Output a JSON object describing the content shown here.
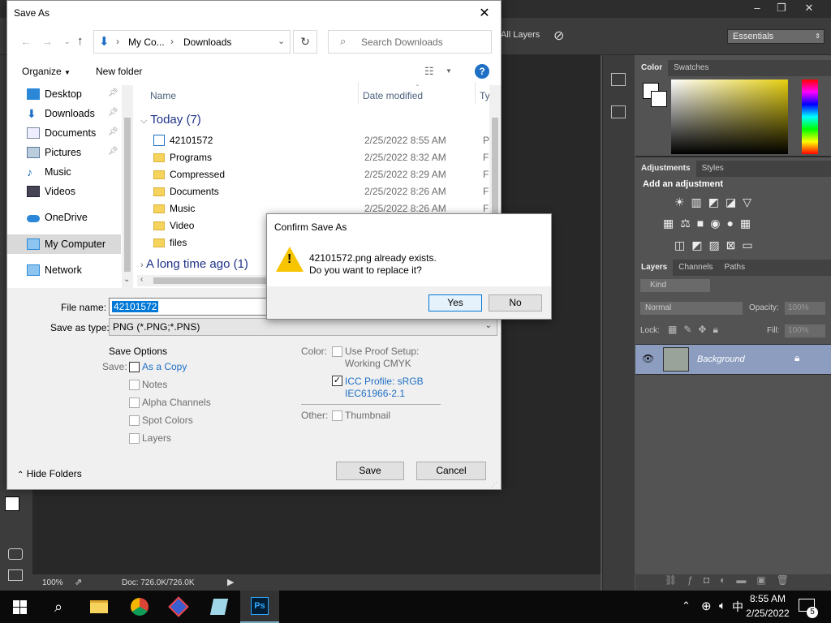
{
  "photoshop": {
    "layers_toggle": "All Layers",
    "workspace": "Essentials",
    "status_zoom": "100%",
    "status_doc": "Doc: 726.0K/726.0K",
    "color_panel": {
      "tabs": [
        "Color",
        "Swatches"
      ]
    },
    "adjustments_panel": {
      "tabs": [
        "Adjustments",
        "Styles"
      ],
      "heading": "Add an adjustment"
    },
    "layers_panel": {
      "tabs": [
        "Layers",
        "Channels",
        "Paths"
      ],
      "kind_filter": "Kind",
      "blend_mode": "Normal",
      "opacity_label": "Opacity:",
      "opacity_value": "100%",
      "lock_label": "Lock:",
      "fill_label": "Fill:",
      "fill_value": "100%",
      "layer_name": "Background"
    }
  },
  "save_dialog": {
    "title": "Save As",
    "breadcrumb": [
      "My Co...",
      "Downloads"
    ],
    "search_placeholder": "Search Downloads",
    "organize": "Organize",
    "new_folder": "New folder",
    "sidebar": [
      {
        "label": "Desktop",
        "icon": "desktop-icon",
        "pinned": true
      },
      {
        "label": "Downloads",
        "icon": "downloads-icon",
        "pinned": true
      },
      {
        "label": "Documents",
        "icon": "documents-icon",
        "pinned": true
      },
      {
        "label": "Pictures",
        "icon": "pictures-icon",
        "pinned": true
      },
      {
        "label": "Music",
        "icon": "music-icon",
        "pinned": false
      },
      {
        "label": "Videos",
        "icon": "videos-icon",
        "pinned": false
      },
      {
        "label": "OneDrive",
        "icon": "onedrive-icon",
        "pinned": false
      },
      {
        "label": "My Computer",
        "icon": "computer-icon",
        "pinned": false
      },
      {
        "label": "Network",
        "icon": "network-icon",
        "pinned": false
      }
    ],
    "columns": {
      "name": "Name",
      "date": "Date modified",
      "type": "Ty"
    },
    "group_today": "Today (7)",
    "group_older": "A long time ago (1)",
    "files": [
      {
        "name": "42101572",
        "date": "2/25/2022 8:55 AM",
        "type": "PI"
      },
      {
        "name": "Programs",
        "date": "2/25/2022 8:32 AM",
        "type": "Fi"
      },
      {
        "name": "Compressed",
        "date": "2/25/2022 8:29 AM",
        "type": "Fi"
      },
      {
        "name": "Documents",
        "date": "2/25/2022 8:26 AM",
        "type": "Fi"
      },
      {
        "name": "Music",
        "date": "2/25/2022 8:26 AM",
        "type": "Fi"
      },
      {
        "name": "Video",
        "date": "",
        "type": ""
      },
      {
        "name": "files",
        "date": "",
        "type": ""
      }
    ],
    "file_name_label": "File name:",
    "file_name_value": "42101572",
    "save_type_label": "Save as type:",
    "save_type_value": "PNG (*.PNG;*.PNS)",
    "save_options": "Save Options",
    "save_label": "Save:",
    "as_a_copy": "As a Copy",
    "notes": "Notes",
    "alpha_channels": "Alpha Channels",
    "spot_colors": "Spot Colors",
    "layers": "Layers",
    "color_label": "Color:",
    "use_proof": "Use Proof Setup:",
    "working_cmyk": "Working CMYK",
    "icc_profile": "ICC Profile:  sRGB",
    "icc_profile2": "IEC61966-2.1",
    "other_label": "Other:",
    "thumbnail": "Thumbnail",
    "hide_folders": "Hide Folders",
    "save_button": "Save",
    "cancel_button": "Cancel"
  },
  "confirm": {
    "title": "Confirm Save As",
    "line1": "42101572.png already exists.",
    "line2": "Do you want to replace it?",
    "yes": "Yes",
    "no": "No"
  },
  "taskbar": {
    "time": "8:55 AM",
    "date": "2/25/2022",
    "notifications": "5"
  },
  "colors": {
    "accent": "#0078d7",
    "ps_dark": "#535353",
    "selection": "#cce8ff"
  }
}
